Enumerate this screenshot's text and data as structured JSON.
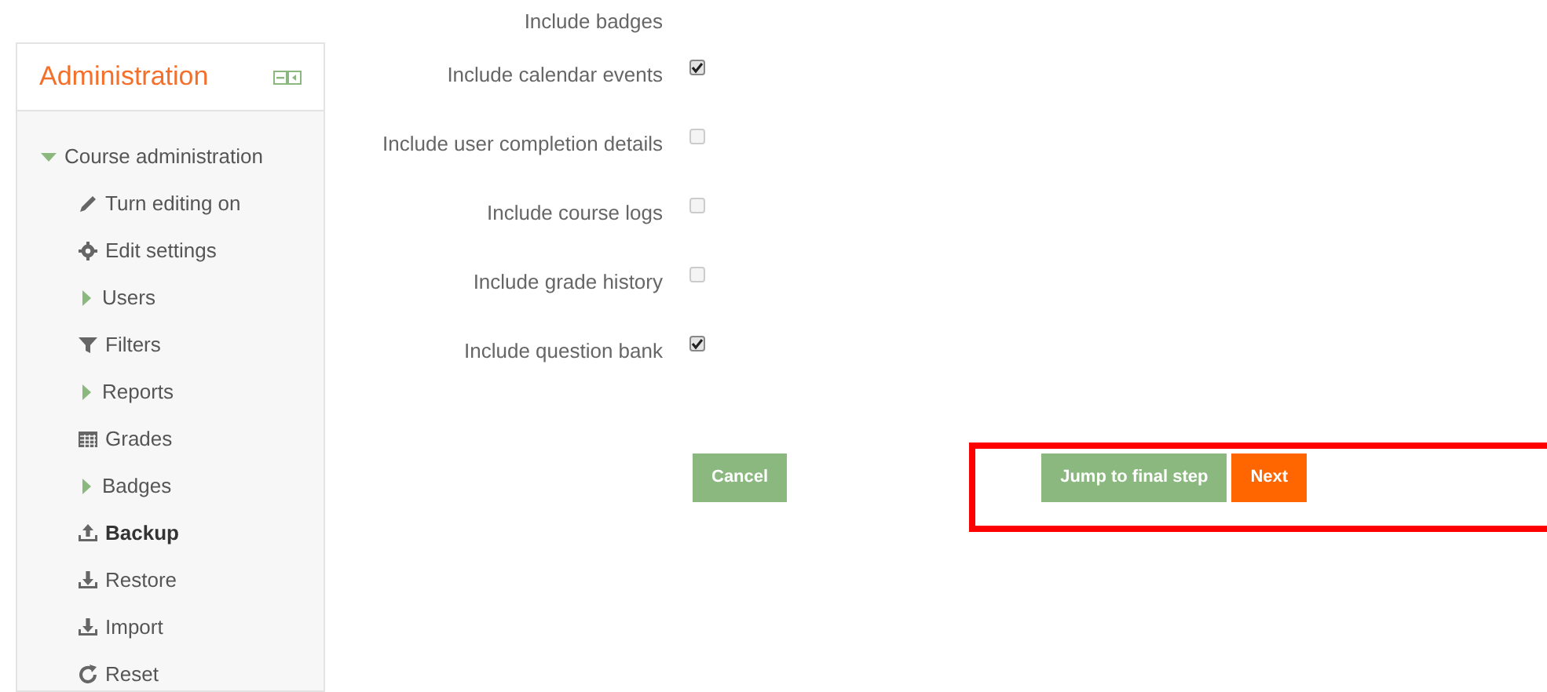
{
  "sidebar": {
    "title": "Administration",
    "items": [
      {
        "kind": "branch",
        "label": "Course administration",
        "expanded": true,
        "selected": false,
        "children": [
          {
            "kind": "pencil",
            "label": "Turn editing on",
            "selected": false
          },
          {
            "kind": "gear",
            "label": "Edit settings",
            "selected": false
          },
          {
            "kind": "branch",
            "label": "Users",
            "expanded": false,
            "selected": false
          },
          {
            "kind": "filter",
            "label": "Filters",
            "selected": false
          },
          {
            "kind": "branch",
            "label": "Reports",
            "expanded": false,
            "selected": false
          },
          {
            "kind": "table",
            "label": "Grades",
            "selected": false
          },
          {
            "kind": "branch",
            "label": "Badges",
            "expanded": false,
            "selected": false
          },
          {
            "kind": "upload",
            "label": "Backup",
            "selected": true
          },
          {
            "kind": "download",
            "label": "Restore",
            "selected": false
          },
          {
            "kind": "download",
            "label": "Import",
            "selected": false
          },
          {
            "kind": "reset",
            "label": "Reset",
            "selected": false
          }
        ]
      }
    ]
  },
  "settings": [
    {
      "label": "Include badges"
    },
    {
      "label": "Include calendar events",
      "checked": true
    },
    {
      "label": "Include user completion details",
      "checked": false
    },
    {
      "label": "Include course logs",
      "checked": false
    },
    {
      "label": "Include grade history",
      "checked": false
    },
    {
      "label": "Include question bank",
      "checked": true
    }
  ],
  "buttons": [
    {
      "label": "Cancel",
      "kind": "secondary"
    },
    {
      "label": "Jump to final step",
      "kind": "secondary"
    },
    {
      "label": "Next",
      "kind": "primary"
    }
  ]
}
